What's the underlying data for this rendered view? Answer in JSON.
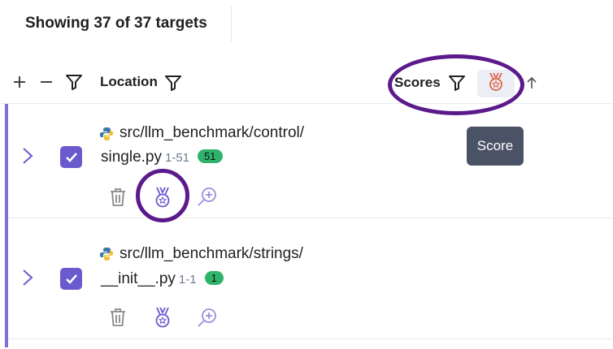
{
  "toolbar": {
    "showing_text": "Showing 37 of 37 targets"
  },
  "header": {
    "location_label": "Location",
    "scores_label": "Scores",
    "icons": [
      "plus-icon",
      "minus-icon",
      "filter-icon",
      "medal-icon",
      "arrow-up-icon"
    ]
  },
  "tooltip": {
    "text": "Score"
  },
  "rows": [
    {
      "path_dir": "src/llm_benchmark/control/",
      "file_name": "single.py",
      "line_range": "1-51",
      "badge": "51",
      "checked": true
    },
    {
      "path_dir": "src/llm_benchmark/strings/",
      "file_name": "__init__.py",
      "line_range": "1-1",
      "badge": "1",
      "checked": true
    }
  ],
  "colors": {
    "accent": "#7c6fd6",
    "checkbox": "#6a5acd",
    "badge": "#2fb36a",
    "highlight": "#5b1a8c",
    "tooltip_bg": "#4a5366"
  }
}
